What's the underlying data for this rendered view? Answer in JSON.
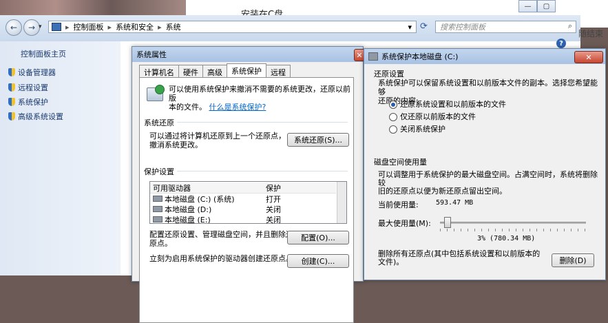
{
  "background_doc": {
    "text_top": "安装在C盘。",
    "text_right": "随结束"
  },
  "explorer": {
    "breadcrumb": [
      "控制面板",
      "系统和安全",
      "系统"
    ],
    "search_placeholder": "搜索控制面板",
    "sidebar": {
      "home": "控制面板主页",
      "items": [
        "设备管理器",
        "远程设置",
        "系统保护",
        "高级系统设置"
      ]
    }
  },
  "sysprops": {
    "title": "系统属性",
    "tabs": [
      "计算机名",
      "硬件",
      "高级",
      "系统保护",
      "远程"
    ],
    "active_tab": "系统保护",
    "intro_line1": "可以使用系统保护来撤消不需要的系统更改，还原以前版",
    "intro_line2": "本的文件。",
    "intro_link": "什么是系统保护?",
    "restore_section": "系统还原",
    "restore_desc1": "可以通过将计算机还原到上一个还原点，",
    "restore_desc2": "撤消系统更改。",
    "restore_button": "系统还原(S)...",
    "protect_section": "保护设置",
    "col_drive": "可用驱动器",
    "col_protect": "保护",
    "drives": [
      {
        "name": "本地磁盘 (C:) (系统)",
        "status": "打开"
      },
      {
        "name": "本地磁盘 (D:)",
        "status": "关闭"
      },
      {
        "name": "本地磁盘 (E:)",
        "status": "关闭"
      }
    ],
    "config_desc1": "配置还原设置、管理磁盘空间，并且删除还",
    "config_desc2": "原点。",
    "config_button": "配置(O)...",
    "create_desc": "立刻为启用系统保护的驱动器创建还原点。",
    "create_button": "创建(C)..."
  },
  "protect": {
    "title": "系统保护本地磁盘 (C:)",
    "close_glyph": "✕",
    "restore_section": "还原设置",
    "restore_desc1": "系统保护可以保留系统设置和以前版本文件的副本。选择您希望能够",
    "restore_desc2": "还原的内容:",
    "options": [
      "还原系统设置和以前版本的文件",
      "仅还原以前版本的文件",
      "关闭系统保护"
    ],
    "selected_option": 0,
    "disk_section": "磁盘空间使用量",
    "disk_desc1": "可以调整用于系统保护的最大磁盘空间。占满空间时，系统将删除较",
    "disk_desc2": "旧的还原点以便为新还原点留出空间。",
    "current_label": "当前使用量:",
    "current_value": "593.47 MB",
    "max_label": "最大使用量(M):",
    "max_fraction": 0.03,
    "max_readout": "3% (780.34 MB)",
    "delete_desc1": "删除所有还原点(其中包括系统设置和以前版本的",
    "delete_desc2": "文件)。",
    "delete_button": "删除(D)"
  },
  "icons": {
    "back": "←",
    "forward": "→",
    "dropdown": "▾",
    "refresh": "⟳",
    "search": "⌕",
    "help": "?"
  }
}
